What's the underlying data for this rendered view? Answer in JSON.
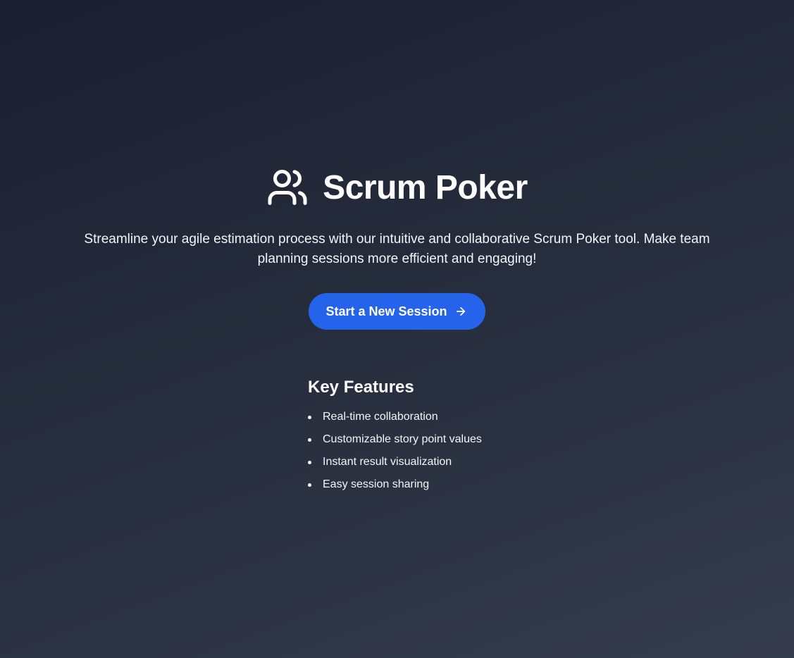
{
  "app": {
    "title": "Scrum Poker",
    "icon": "users-icon"
  },
  "hero": {
    "tagline": "Streamline your agile estimation process with our intuitive and collaborative Scrum Poker tool. Make team planning sessions more efficient and engaging!",
    "cta_label": "Start a New Session",
    "cta_icon": "arrow-right-icon",
    "cta_color": "#2563eb"
  },
  "features": {
    "heading": "Key Features",
    "items": [
      {
        "label": "Real-time collaboration"
      },
      {
        "label": "Customizable story point values"
      },
      {
        "label": "Instant result visualization"
      },
      {
        "label": "Easy session sharing"
      }
    ]
  }
}
